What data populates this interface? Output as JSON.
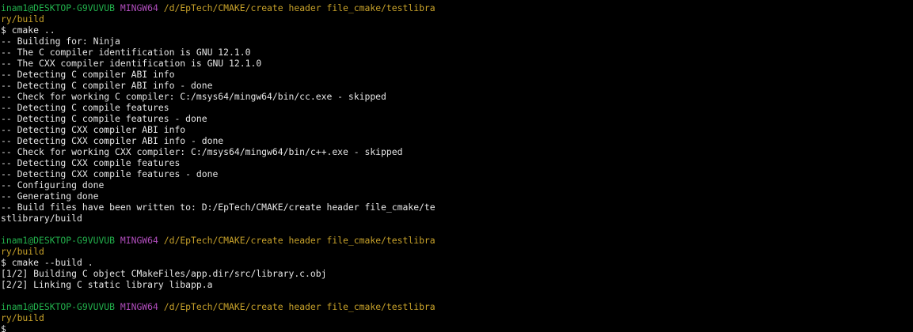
{
  "prompt": {
    "user_host": "inam1@DESKTOP-G9VUVUB",
    "shell": "MINGW64",
    "path_line1": "/d/EpTech/CMAKE/create header file_cmake/testlibra",
    "path_line2": "ry/build",
    "symbol": "$ "
  },
  "blocks": [
    {
      "command": "cmake ..",
      "output": [
        "-- Building for: Ninja",
        "-- The C compiler identification is GNU 12.1.0",
        "-- The CXX compiler identification is GNU 12.1.0",
        "-- Detecting C compiler ABI info",
        "-- Detecting C compiler ABI info - done",
        "-- Check for working C compiler: C:/msys64/mingw64/bin/cc.exe - skipped",
        "-- Detecting C compile features",
        "-- Detecting C compile features - done",
        "-- Detecting CXX compiler ABI info",
        "-- Detecting CXX compiler ABI info - done",
        "-- Check for working CXX compiler: C:/msys64/mingw64/bin/c++.exe - skipped",
        "-- Detecting CXX compile features",
        "-- Detecting CXX compile features - done",
        "-- Configuring done",
        "-- Generating done",
        "-- Build files have been written to: D:/EpTech/CMAKE/create header file_cmake/te",
        "stlibrary/build"
      ]
    },
    {
      "command": "cmake --build .",
      "output": [
        "[1/2] Building C object CMakeFiles/app.dir/src/library.c.obj",
        "[2/2] Linking C static library libapp.a"
      ]
    }
  ]
}
